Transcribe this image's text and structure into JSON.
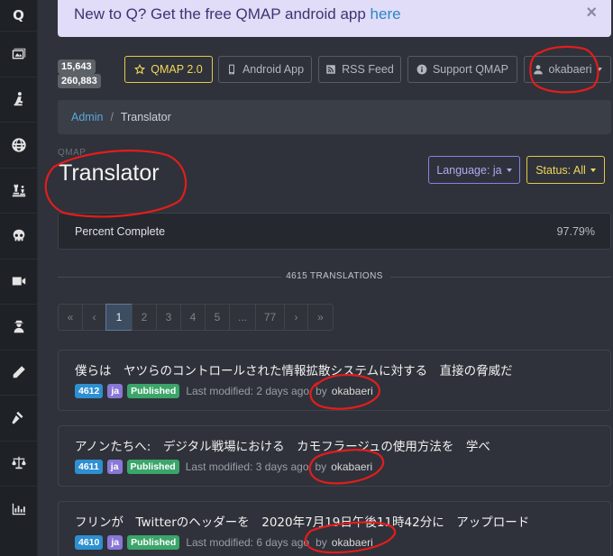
{
  "sidebar": {
    "logo": "Q",
    "items": [
      {
        "icon": "images-icon"
      },
      {
        "icon": "kneeling-figure-icon"
      },
      {
        "icon": "globe-icon"
      },
      {
        "icon": "chess-icon"
      },
      {
        "icon": "skull-icon"
      },
      {
        "icon": "video-icon"
      },
      {
        "icon": "user-secret-icon"
      },
      {
        "icon": "pencil-icon"
      },
      {
        "icon": "gavel-icon"
      },
      {
        "icon": "balance-scale-icon"
      },
      {
        "icon": "bar-chart-icon"
      }
    ]
  },
  "banner": {
    "text": "New to Q? Get the free QMAP android app ",
    "link": "here",
    "close": "×"
  },
  "counters": {
    "count1": "15,643",
    "count2": "260,883"
  },
  "topnav": {
    "qmap": "QMAP 2.0",
    "android": "Android App",
    "rss": "RSS Feed",
    "support": "Support QMAP",
    "user": "okabaeri"
  },
  "breadcrumb": {
    "admin": "Admin",
    "sep": "/",
    "current": "Translator"
  },
  "header": {
    "pretitle": "QMAP",
    "title": "Translator",
    "language_dd": "Language: ja",
    "status_dd": "Status: All"
  },
  "progress": {
    "label": "Percent Complete",
    "value": "97.79%",
    "fraction": 0.9779
  },
  "divider": {
    "text": "4615 TRANSLATIONS"
  },
  "pagination": [
    "«",
    "‹",
    "1",
    "2",
    "3",
    "4",
    "5",
    "...",
    "77",
    "›",
    "»"
  ],
  "pagination_active": "1",
  "translations": [
    {
      "text": "僕らは　ヤツらのコントロールされた情報拡散システムに対する　直接の脅威だ",
      "id": "4612",
      "lang": "ja",
      "status": "Published",
      "modified": "Last modified: 2 days ago",
      "by": "by",
      "user": "okabaeri"
    },
    {
      "text": "アノンたちへ:　デジタル戦場における　カモフラージュの使用方法を　学べ",
      "id": "4611",
      "lang": "ja",
      "status": "Published",
      "modified": "Last modified: 3 days ago",
      "by": "by",
      "user": "okabaeri"
    },
    {
      "text": "フリンが　Twitterのヘッダーを　2020年7月19日午後11時42分に　アップロード",
      "id": "4610",
      "lang": "ja",
      "status": "Published",
      "modified": "Last modified: 6 days ago",
      "by": "by",
      "user": "okabaeri"
    }
  ]
}
